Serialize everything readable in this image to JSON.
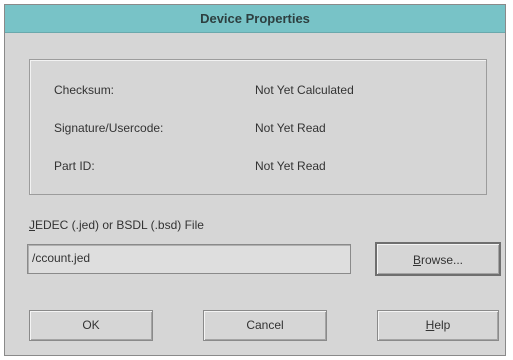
{
  "dialog": {
    "title": "Device Properties"
  },
  "info": {
    "rows": [
      {
        "label": "Checksum:",
        "value": "Not Yet Calculated"
      },
      {
        "label": "Signature/Usercode:",
        "value": "Not Yet Read"
      },
      {
        "label": "Part ID:",
        "value": "Not Yet Read"
      }
    ]
  },
  "file": {
    "label_mnemonic": "J",
    "label_rest": "EDEC (.jed) or BSDL (.bsd) File",
    "value": "/ccount.jed"
  },
  "buttons": {
    "browse_mnemonic": "B",
    "browse_rest": "rowse...",
    "ok": "OK",
    "cancel": "Cancel",
    "help_mnemonic": "H",
    "help_rest": "elp"
  }
}
